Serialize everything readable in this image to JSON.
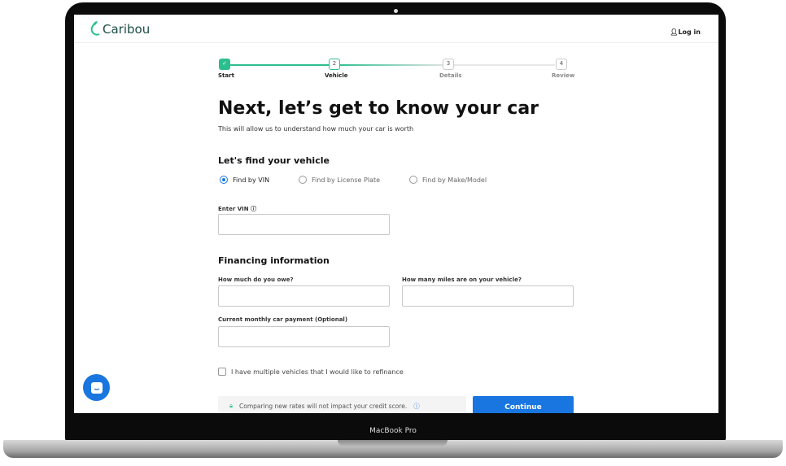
{
  "device": {
    "label": "MacBook Pro"
  },
  "header": {
    "brand": "Caribou",
    "login": "Log in"
  },
  "stepper": {
    "steps": [
      {
        "num": "✓",
        "label": "Start",
        "state": "done"
      },
      {
        "num": "2",
        "label": "Vehicle",
        "state": "active"
      },
      {
        "num": "3",
        "label": "Details",
        "state": "pending"
      },
      {
        "num": "4",
        "label": "Review",
        "state": "pending"
      }
    ]
  },
  "page": {
    "title": "Next, let’s get to know your car",
    "subtitle": "This will allow us to understand how much your car is worth"
  },
  "find": {
    "heading": "Let's find your vehicle",
    "options": [
      "Find by VIN",
      "Find by License Plate",
      "Find by Make/Model"
    ],
    "selected": "Find by VIN",
    "vin_label": "Enter VIN",
    "vin_value": ""
  },
  "financing": {
    "heading": "Financing information",
    "owe_label": "How much do you owe?",
    "miles_label": "How many miles are on your vehicle?",
    "payment_label": "Current monthly car payment (Optional)",
    "multiple_label": "I have multiple vehicles that I would like to refinance",
    "multiple_checked": false
  },
  "footer": {
    "note": "Comparing new rates will not impact your credit score.",
    "continue": "Continue"
  },
  "colors": {
    "accent": "#1976e0",
    "brand": "#2bbf8f"
  }
}
